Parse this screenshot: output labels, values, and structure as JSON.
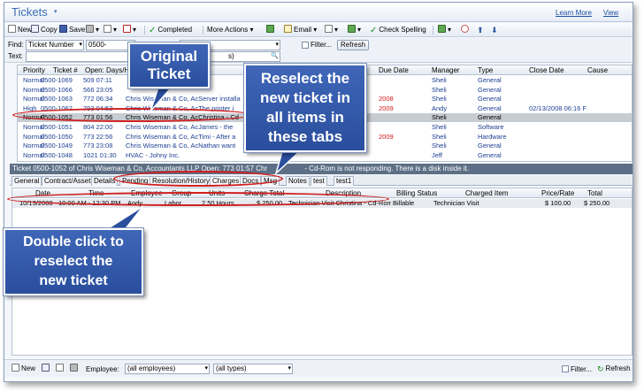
{
  "header": {
    "title": "Tickets",
    "learn_more": "Learn More",
    "view": "View"
  },
  "toolbar": {
    "new": "New",
    "copy": "Copy",
    "save": "Save",
    "completed": "Completed",
    "more_actions": "More Actions",
    "email": "Email",
    "check_spelling": "Check Spelling"
  },
  "find": {
    "find_label": "Find:",
    "field": "Ticket Number",
    "value": "0500-",
    "text_label": "Text:",
    "filter_label": "Filter...",
    "refresh": "Refresh",
    "partial": "s)"
  },
  "ticket_grid": {
    "columns": [
      "Priority",
      "Ticket #",
      "Open: Days/Hrs",
      "Due Date",
      "Manager",
      "Type",
      "Close Date",
      "Cause"
    ],
    "rows": [
      {
        "priority": "Normal",
        "ticket": "0500-1069",
        "open": "509 07:11",
        "desc": "",
        "due": "",
        "manager": "Sheli",
        "type": "General",
        "close": "",
        "selected": false
      },
      {
        "priority": "Normal",
        "ticket": "0500-1066",
        "open": "566 23:05",
        "desc": "",
        "due": "",
        "manager": "Sheli",
        "type": "General",
        "close": "",
        "selected": false
      },
      {
        "priority": "Normal",
        "ticket": "0500-1063",
        "open": "772 06:34",
        "desc": "Chris Wiseman & Co, AcServer installa",
        "due": "2008",
        "manager": "Sheli",
        "type": "General",
        "close": "",
        "selected": false
      },
      {
        "priority": "High",
        "ticket": "0500-1062",
        "open": "793 04:52",
        "desc": "Chris Wiseman & Co, AcThe printer i",
        "due": "2009",
        "manager": "Andy",
        "type": "General",
        "close": "02/13/2008  06:16 F",
        "selected": false
      },
      {
        "priority": "Normal",
        "ticket": "0500-1052",
        "open": "773 01:56",
        "desc": "Chris Wiseman & Co, AcChristina - Cd",
        "due": "",
        "manager": "Sheli",
        "type": "General",
        "close": "",
        "selected": true
      },
      {
        "priority": "Normal",
        "ticket": "0500-1051",
        "open": "804 22:00",
        "desc": "Chris Wiseman & Co, AcJames - the",
        "due": "",
        "manager": "Sheli",
        "type": "Software",
        "close": "",
        "selected": false
      },
      {
        "priority": "Normal",
        "ticket": "0500-1050",
        "open": "773 22:56",
        "desc": "Chris Wiseman & Co, AcTimi - After a",
        "due": "2009",
        "manager": "Sheli",
        "type": "Hardware",
        "close": "",
        "selected": false
      },
      {
        "priority": "Normal",
        "ticket": "0500-1049",
        "open": "773 23:08",
        "desc": "Chris Wiseman & Co, AcNathan want",
        "due": "",
        "manager": "Sheli",
        "type": "General",
        "close": "",
        "selected": false
      },
      {
        "priority": "Normal",
        "ticket": "0500-1048",
        "open": "1021 01:30",
        "desc": "HVAC - Johny Inc.",
        "due": "",
        "manager": "Jeff",
        "type": "General",
        "close": "",
        "selected": false
      }
    ]
  },
  "detail": {
    "header": "Ticket  0500-1052 of Chris Wiseman & Co, Accountants LLP Open:  773 01:57 Chr",
    "header_tail": "- Cd-Rom is not responding. There is a disk inside it.",
    "tabs": [
      "General",
      "Contract/Asset",
      "Details",
      "Pending",
      "Resolution/History",
      "Charges",
      "Docs",
      "Msg",
      "Notes",
      "test",
      "test1"
    ],
    "active_tab": "Charges"
  },
  "charges": {
    "columns": [
      "Date",
      "Time",
      "Employee",
      "Group",
      "Units",
      "Charge Total",
      "Description",
      "Billing Status",
      "Charged Item",
      "Price/Rate",
      "Total"
    ],
    "row": {
      "date": "10/13/2008",
      "time": "10:00 AM - 12:30 PM",
      "employee": "Andy",
      "group": "Labor",
      "units": "2.50 Hours",
      "charge_total": "$ 250.00",
      "description": "Technician Visit Christina - Cd-Rom i",
      "billing_status": "Billable",
      "charged_item": "Technician Visit",
      "price_rate": "$ 100.00",
      "total": "$ 250.00"
    }
  },
  "bottom": {
    "new": "New",
    "employee_label": "Employee:",
    "employee_value": "(all employees)",
    "type_value": "(all types)",
    "filter_label": "Filter...",
    "refresh": "Refresh"
  },
  "callouts": {
    "original": "Original\nTicket",
    "reselect_tabs": "Reselect the\nnew ticket in\nall items in\nthese tabs",
    "double_click": "Double click to\nreselect the\nnew ticket"
  },
  "colors": {
    "callout": "#2f56a8",
    "highlight": "#d11f1f",
    "link": "#1c3f93"
  }
}
